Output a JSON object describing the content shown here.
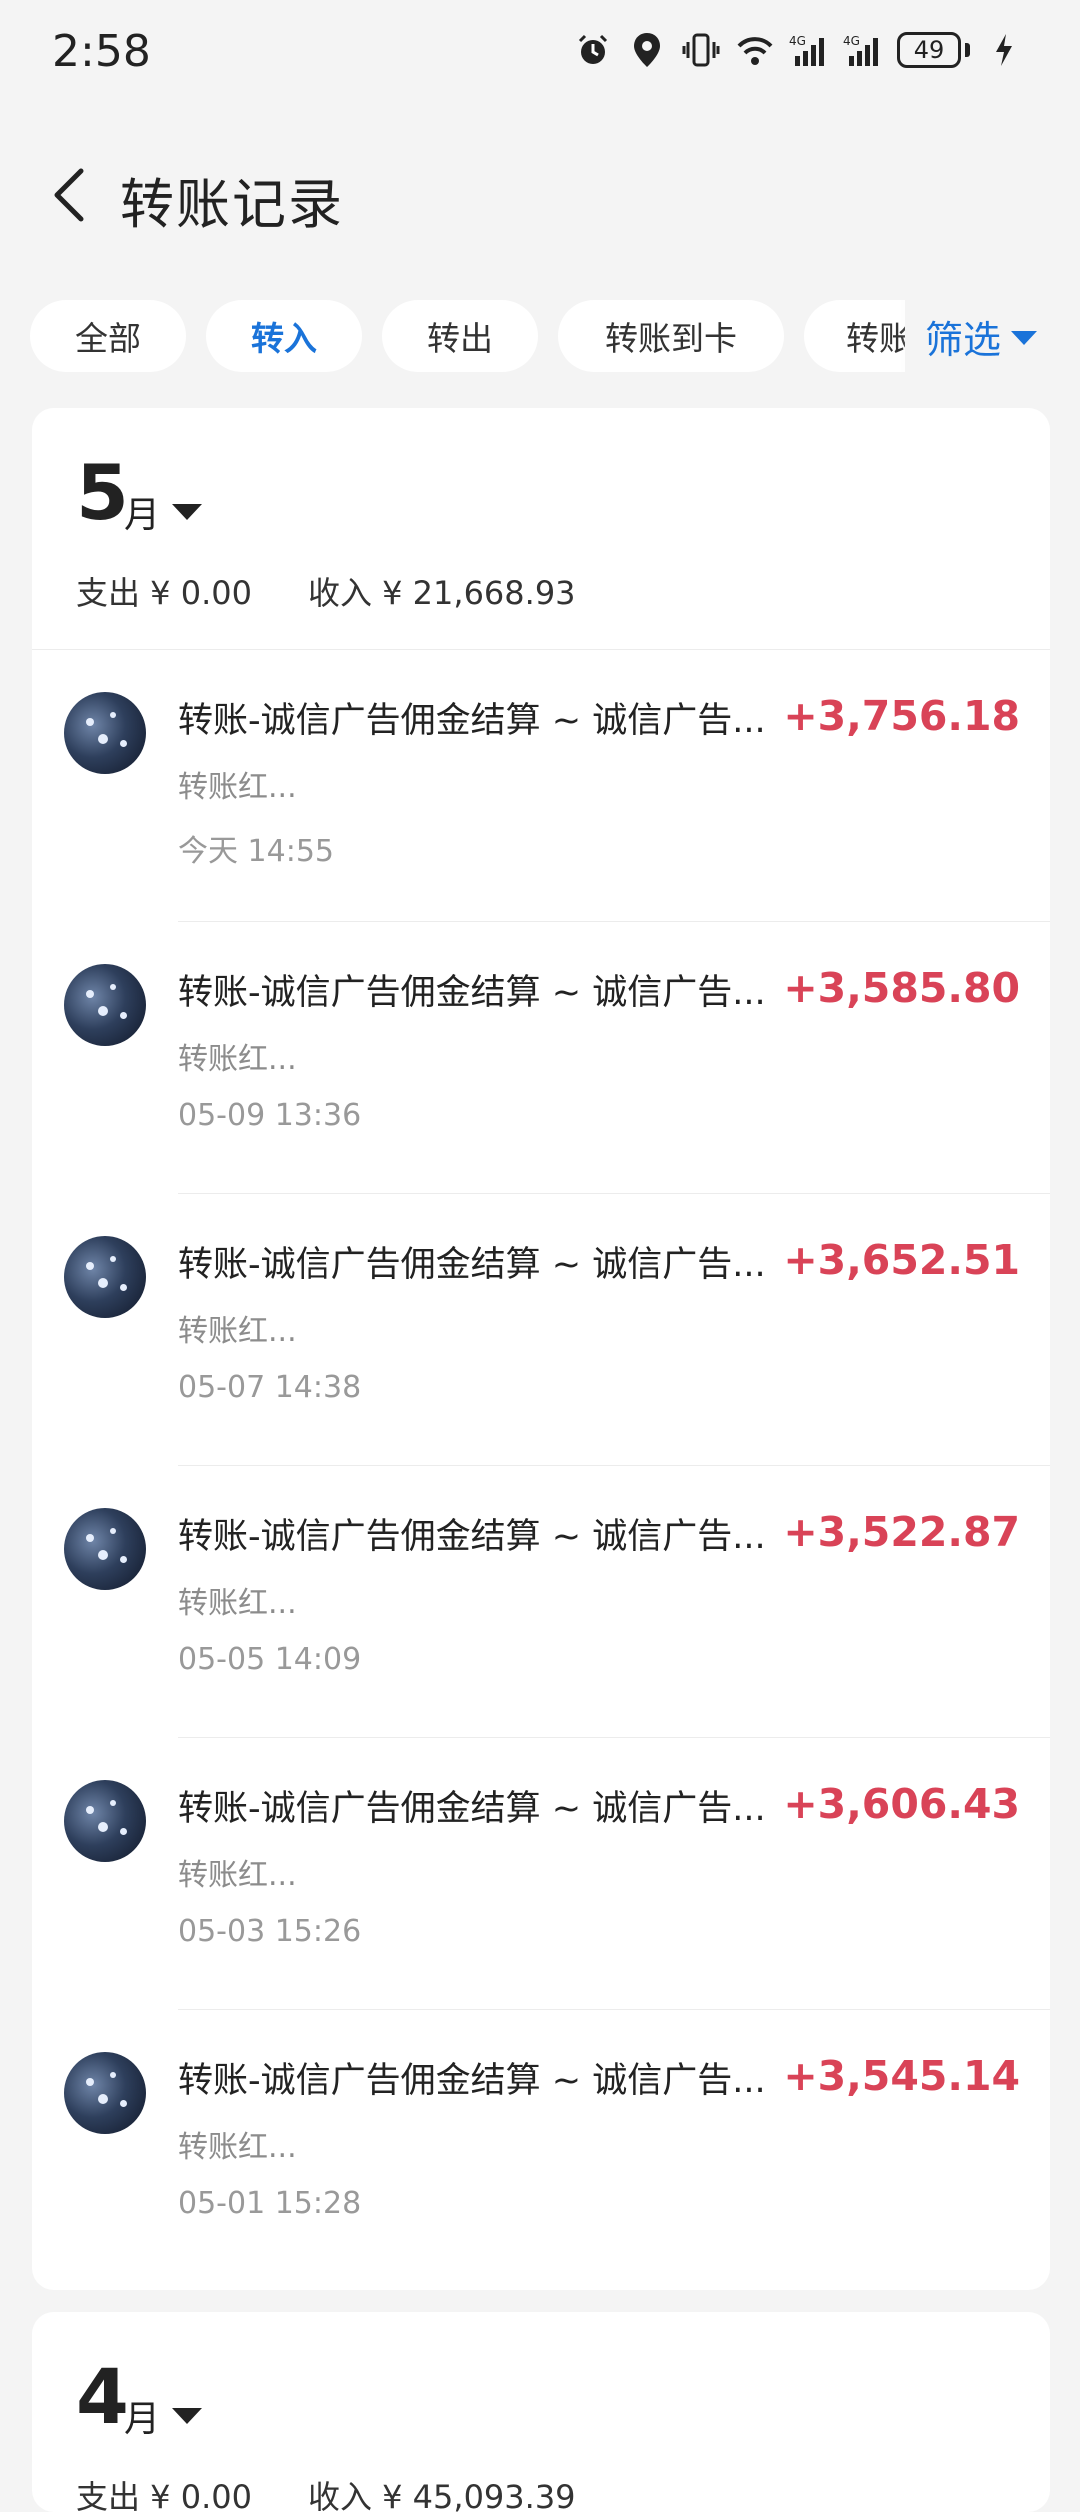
{
  "status_bar": {
    "time": "2:58",
    "battery": "49",
    "icons": [
      "alarm-icon",
      "location-icon",
      "vibrate-icon",
      "wifi-6-icon",
      "signal-4g-icon",
      "signal-4g-icon",
      "charging-icon"
    ],
    "net1": "4G",
    "net2": "4G"
  },
  "header": {
    "title": "转账记录",
    "back_icon": "chevron-left-icon"
  },
  "tabs": [
    {
      "label": "全部",
      "active": false
    },
    {
      "label": "转入",
      "active": true
    },
    {
      "label": "转出",
      "active": false
    },
    {
      "label": "转账到卡",
      "active": false
    },
    {
      "label": "转账",
      "active": false
    }
  ],
  "filter": {
    "label": "筛选"
  },
  "months": [
    {
      "month": "5",
      "unit": "月",
      "expense": "支出 ¥ 0.00",
      "income": "收入 ¥ 21,668.93",
      "transactions": [
        {
          "title": "转账-诚信广告佣金结算 ~ 诚信广告...",
          "subtitle": "转账红...",
          "time": "今天 14:55",
          "amount": "+3,756.18"
        },
        {
          "title": "转账-诚信广告佣金结算 ~ 诚信广告...",
          "subtitle": "转账红...",
          "time": "05-09 13:36",
          "amount": "+3,585.80"
        },
        {
          "title": "转账-诚信广告佣金结算 ~ 诚信广告...",
          "subtitle": "转账红...",
          "time": "05-07 14:38",
          "amount": "+3,652.51"
        },
        {
          "title": "转账-诚信广告佣金结算 ~ 诚信广告...",
          "subtitle": "转账红...",
          "time": "05-05 14:09",
          "amount": "+3,522.87"
        },
        {
          "title": "转账-诚信广告佣金结算 ~ 诚信广告...",
          "subtitle": "转账红...",
          "time": "05-03 15:26",
          "amount": "+3,606.43"
        },
        {
          "title": "转账-诚信广告佣金结算 ~ 诚信广告...",
          "subtitle": "转账红...",
          "time": "05-01 15:28",
          "amount": "+3,545.14"
        }
      ]
    },
    {
      "month": "4",
      "unit": "月",
      "expense": "支出 ¥ 0.00",
      "income": "收入 ¥ 45,093.39"
    }
  ],
  "colors": {
    "accent": "#1a73d9",
    "income_red": "#d94357",
    "background": "#f4f4f4"
  }
}
